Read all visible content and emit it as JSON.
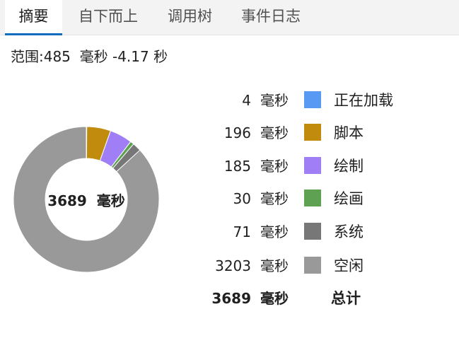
{
  "tabs": [
    {
      "label": "摘要",
      "active": true
    },
    {
      "label": "自下而上",
      "active": false
    },
    {
      "label": "调用树",
      "active": false
    },
    {
      "label": "事件日志",
      "active": false
    }
  ],
  "range_text": "范围:485  毫秒 -4.17 秒",
  "chart_data": {
    "type": "pie",
    "title": "",
    "center_value": "3689",
    "center_unit": "毫秒",
    "unit": "毫秒",
    "slices": [
      {
        "label": "正在加载",
        "value": 4,
        "color": "#5899f4"
      },
      {
        "label": "脚本",
        "value": 196,
        "color": "#c18c0e"
      },
      {
        "label": "绘制",
        "value": 185,
        "color": "#a07ef5"
      },
      {
        "label": "绘画",
        "value": 30,
        "color": "#5ea152"
      },
      {
        "label": "系统",
        "value": 71,
        "color": "#777777"
      },
      {
        "label": "空闲",
        "value": 3203,
        "color": "#999999"
      }
    ],
    "total": {
      "label": "总计",
      "value": 3689
    }
  }
}
